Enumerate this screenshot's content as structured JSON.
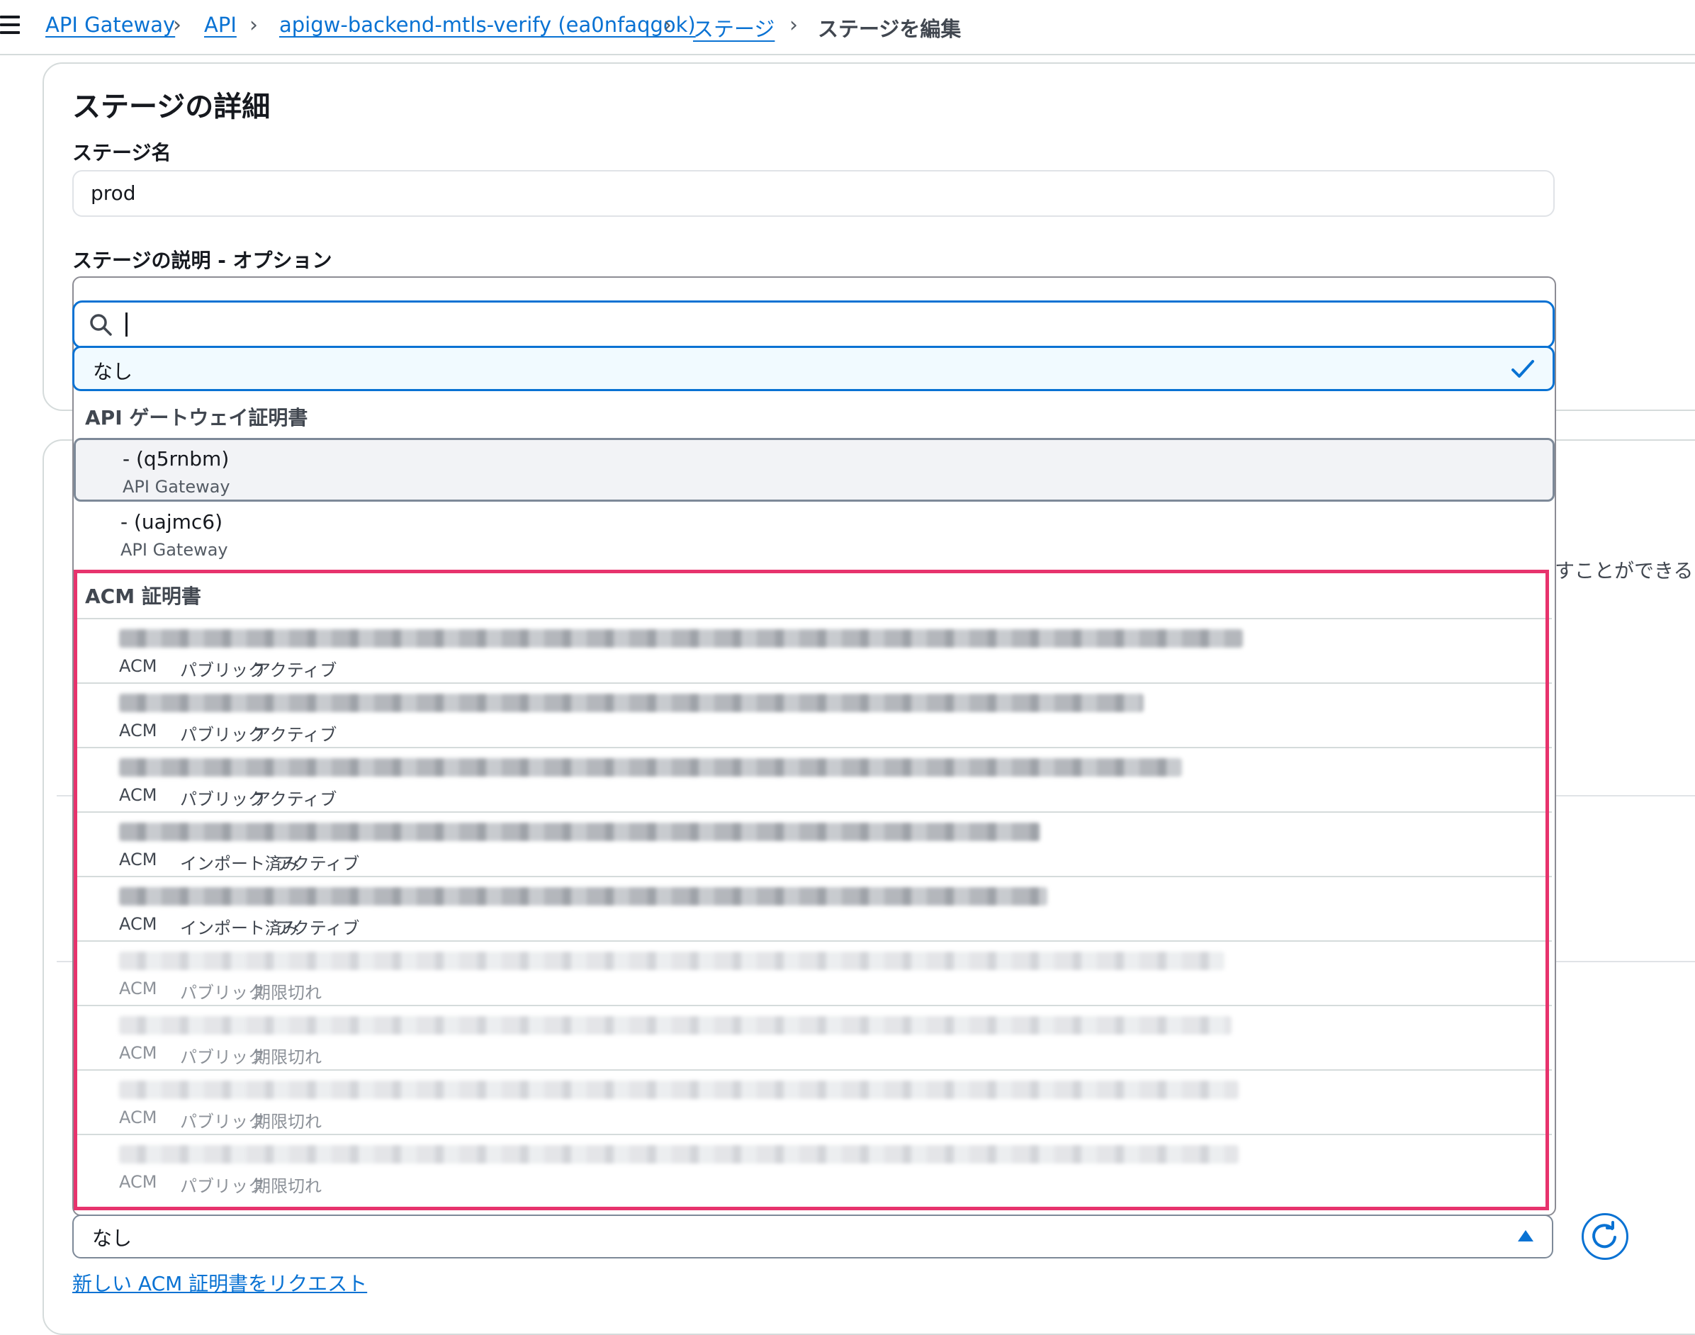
{
  "breadcrumb": {
    "items": [
      "API Gateway",
      "API",
      "apigw-backend-mtls-verify (ea0nfaqgok)",
      "ステージ"
    ],
    "current": "ステージを編集"
  },
  "stage_details": {
    "title": "ステージの詳細",
    "stage_name_label": "ステージ名",
    "stage_name_value": "prod",
    "description_label": "ステージの説明 - オプション"
  },
  "side_text": "すことができる",
  "dropdown": {
    "search_value": "",
    "none_option": "なし",
    "api_group_label": "API ゲートウェイ証明書",
    "api_certs": [
      {
        "name": "- (q5rnbm)",
        "source": "API Gateway"
      },
      {
        "name": "- (uajmc6)",
        "source": "API Gateway"
      }
    ],
    "acm_group_label": "ACM 証明書",
    "acm_certs": [
      {
        "source": "ACM",
        "type": "パブリック",
        "status": "アクティブ"
      },
      {
        "source": "ACM",
        "type": "パブリック",
        "status": "アクティブ"
      },
      {
        "source": "ACM",
        "type": "パブリック",
        "status": "アクティブ"
      },
      {
        "source": "ACM",
        "type": "インポート済み",
        "status": "アクティブ"
      },
      {
        "source": "ACM",
        "type": "インポート済み",
        "status": "アクティブ"
      },
      {
        "source": "ACM",
        "type": "パブリック",
        "status": "期限切れ"
      },
      {
        "source": "ACM",
        "type": "パブリック",
        "status": "期限切れ"
      },
      {
        "source": "ACM",
        "type": "パブリック",
        "status": "期限切れ"
      },
      {
        "source": "ACM",
        "type": "パブリック",
        "status": "期限切れ"
      }
    ]
  },
  "certificate_select": {
    "value": "なし"
  },
  "request_link": "新しい ACM 証明書をリクエスト",
  "colors": {
    "accent": "#0972d3",
    "highlight": "#e7336d"
  }
}
